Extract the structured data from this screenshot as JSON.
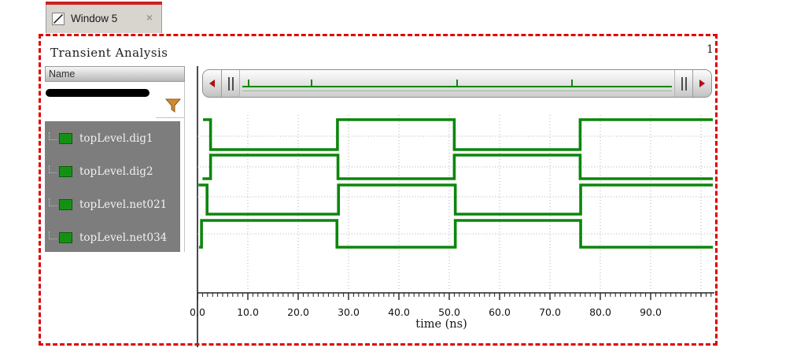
{
  "tab": {
    "title": "Window 5",
    "close_glyph": "×"
  },
  "header": {
    "title": "Transient Analysis",
    "page_number": "1"
  },
  "signal_panel": {
    "column_header": "Name",
    "filter_icon": "funnel-filter-icon",
    "signals": [
      {
        "name": "topLevel.dig1"
      },
      {
        "name": "topLevel.dig2"
      },
      {
        "name": "topLevel.net021"
      },
      {
        "name": "topLevel.net034"
      }
    ],
    "swatch_color": "#149114"
  },
  "scrollbar": {
    "left_arrow": "left-arrow",
    "right_arrow": "right-arrow",
    "preview_tick_fractions": [
      0.02,
      0.165,
      0.5,
      0.765
    ]
  },
  "colors": {
    "trace_green": "#0c860c",
    "selection_red": "#e00000",
    "panel_gray": "#7d7d7d",
    "grid_dot": "#b0b0b0"
  },
  "chart_data": {
    "type": "line",
    "subtype": "digital_timing_waveforms",
    "title": "Transient Analysis",
    "xlabel": "time (ns)",
    "x_range_ns": [
      0,
      102
    ],
    "x_tick_step_ns": 10,
    "x_tick_labels": [
      "0.0",
      "10.0",
      "20.0",
      "30.0",
      "40.0",
      "50.0",
      "60.0",
      "70.0",
      "80.0",
      "90.0"
    ],
    "grid": "dotted",
    "legend_position": "left-panel",
    "y_levels": [
      "low",
      "high"
    ],
    "trace_color": "#0c860c",
    "signals": [
      {
        "name": "topLevel.dig1",
        "initial_level": 1,
        "transitions_ns": [
          2.6,
          27.8,
          51.0,
          76.0
        ],
        "final_level": 1
      },
      {
        "name": "topLevel.dig2",
        "initial_level": 0,
        "transitions_ns": [
          2.6,
          27.9,
          51.0,
          76.0
        ],
        "final_level": 0
      },
      {
        "name": "topLevel.net021",
        "initial_level": 1,
        "transitions_ns": [
          1.9,
          28.0,
          51.2,
          76.1
        ],
        "final_level": 1
      },
      {
        "name": "topLevel.net034",
        "initial_level": 0,
        "transitions_ns": [
          0.8,
          27.7,
          51.2,
          76.1
        ],
        "final_level": 0
      }
    ]
  }
}
